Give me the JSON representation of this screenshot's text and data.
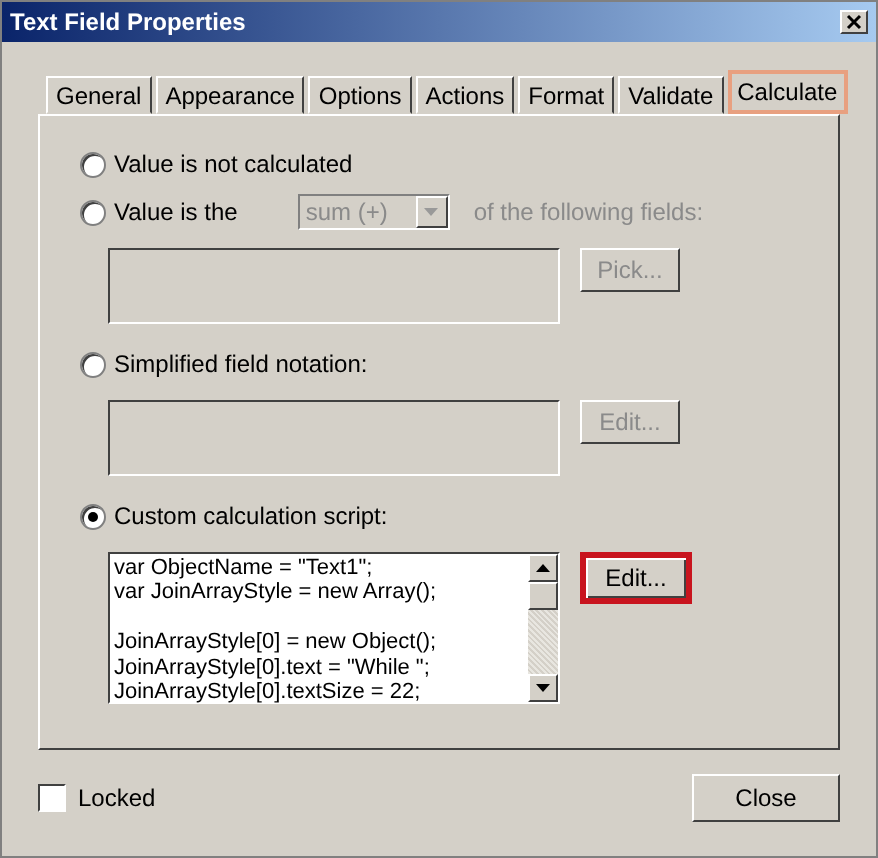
{
  "window": {
    "title": "Text Field Properties"
  },
  "tabs": [
    {
      "label": "General",
      "selected": false
    },
    {
      "label": "Appearance",
      "selected": false
    },
    {
      "label": "Options",
      "selected": false
    },
    {
      "label": "Actions",
      "selected": false
    },
    {
      "label": "Format",
      "selected": false
    },
    {
      "label": "Validate",
      "selected": false
    },
    {
      "label": "Calculate",
      "selected": true
    }
  ],
  "options": [
    {
      "kind": "plain",
      "label": "Value is not calculated",
      "selected": false
    },
    {
      "kind": "function",
      "label": "Value is the",
      "selected": false,
      "dropdown": {
        "value": "sum (+)",
        "disabled": true
      },
      "suffix": "of the following fields:",
      "suffix_disabled": true,
      "button": {
        "label": "Pick...",
        "disabled": true,
        "highlighted": false
      }
    },
    {
      "kind": "field",
      "label": "Simplified field notation:",
      "selected": false,
      "button": {
        "label": "Edit...",
        "disabled": true,
        "highlighted": false
      }
    },
    {
      "kind": "script",
      "label": "Custom calculation script:",
      "selected": true,
      "script": "var ObjectName = \"Text1\";\nvar JoinArrayStyle = new Array();\n\nJoinArrayStyle[0] = new Object();\nJoinArrayStyle[0].text = \"While \";\nJoinArrayStyle[0].textSize = 22;",
      "button": {
        "label": "Edit...",
        "disabled": false,
        "highlighted": true
      }
    }
  ],
  "locked": {
    "label": "Locked",
    "checked": false
  },
  "close_button": {
    "label": "Close"
  }
}
